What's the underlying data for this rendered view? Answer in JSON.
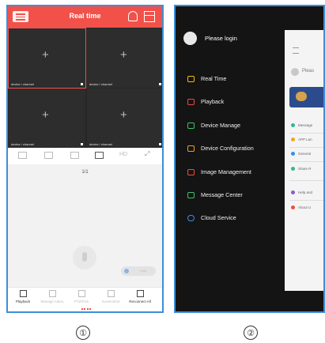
{
  "panel1": {
    "title": "Real time",
    "cells": [
      {
        "caption": "device / channel"
      },
      {
        "caption": "device / channel"
      },
      {
        "caption": "device / channel"
      },
      {
        "caption": "device / channel"
      }
    ],
    "plus_glyph": "+",
    "hd_label": "HD",
    "fullscreen_glyph": "⤢",
    "pager": "1/1",
    "toggle_label": "Hold",
    "bottom_nav": [
      {
        "label": "Playback",
        "icon": "film-icon"
      },
      {
        "label": "Manage Alarm",
        "icon": "alarm-icon"
      },
      {
        "label": "PTZ/Fish",
        "icon": "ptz-icon"
      },
      {
        "label": "Screenshot",
        "icon": "screenshot-icon"
      },
      {
        "label": "Reconnect All",
        "icon": "reconnect-icon"
      }
    ]
  },
  "panel2": {
    "login_label": "Please login",
    "menu": [
      {
        "label": "Real Time",
        "color": "#f2c200"
      },
      {
        "label": "Playback",
        "color": "#f24a3a"
      },
      {
        "label": "Device Manage",
        "color": "#3ac46a"
      },
      {
        "label": "Device Configuration",
        "color": "#f59a1a"
      },
      {
        "label": "Image Management",
        "color": "#f24a3a"
      },
      {
        "label": "Message Center",
        "color": "#3ac46a"
      },
      {
        "label": "Cloud Service",
        "color": "#3a8fe8"
      }
    ],
    "behind": {
      "please": "Pleas",
      "rows": [
        {
          "label": "Message",
          "color": "#2fb89a"
        },
        {
          "label": "APP Lan",
          "color": "#f2a81a"
        },
        {
          "label": "General",
          "color": "#3a8fe8"
        },
        {
          "label": "Share R",
          "color": "#2fb89a"
        },
        {
          "label": "Help and",
          "color": "#8a5ad0"
        },
        {
          "label": "About U",
          "color": "#f24a3a"
        }
      ]
    }
  },
  "labels": {
    "one": "①",
    "two": "②"
  }
}
